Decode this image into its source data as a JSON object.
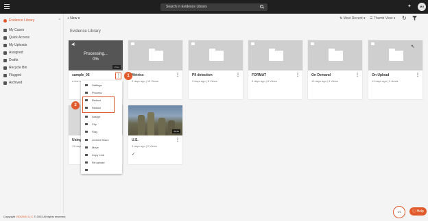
{
  "header": {
    "search_placeholder": "Search in Evidence Library",
    "avatar_initials": "MU"
  },
  "sidebar": {
    "items": [
      {
        "label": "Evidence Library",
        "icon": "library-icon"
      },
      {
        "label": "My Cases",
        "icon": "folder-icon"
      },
      {
        "label": "Quick Access",
        "icon": "bookmark-icon"
      },
      {
        "label": "My Uploads",
        "icon": "upload-icon"
      },
      {
        "label": "Assigned",
        "icon": "assigned-icon"
      },
      {
        "label": "Drafts",
        "icon": "draft-icon"
      },
      {
        "label": "Recycle Bin",
        "icon": "recycle-icon"
      },
      {
        "label": "Flagged",
        "icon": "flag-icon"
      },
      {
        "label": "Archived",
        "icon": "archive-icon"
      }
    ]
  },
  "toolbar": {
    "new_label": "+ New",
    "sort_label": "Most Recent",
    "view_label": "Thumb View"
  },
  "page_title": "Evidence Library",
  "cards": [
    {
      "title": "sample_05",
      "meta": "a few se",
      "processing_text": "Processing...",
      "processing_percent": "0%",
      "badge": "Video"
    },
    {
      "title": "Metrics",
      "meta": "3 days ago | 19 Views"
    },
    {
      "title": "PII detection",
      "meta": "3 days ago | 8 Views"
    },
    {
      "title": "FORMAT",
      "meta": "3 days ago | 8 Views"
    },
    {
      "title": "On Demand",
      "meta": "13 days ago | 3 Views"
    },
    {
      "title": "On Upload",
      "meta": "13 days ago | 0 views"
    },
    {
      "title": "Using",
      "meta": "13 days"
    },
    {
      "title": "U.S.",
      "meta": "3 days ago | 2 Views",
      "duration": "00:41"
    }
  ],
  "context_menu": {
    "items": [
      "Settings",
      "Process",
      "Redact",
      "Redact",
      "Assign",
      "Clip",
      "Flag",
      "Limited Share",
      "Move",
      "Copy Link",
      "Re-upload"
    ]
  },
  "callouts": [
    "1",
    "2"
  ],
  "footer": {
    "prefix": "Copyright",
    "brand": "VIDIZMO LLC",
    "suffix": "© 2023 All rights reserved."
  },
  "pagination": "1/1",
  "help_label": "Help"
}
